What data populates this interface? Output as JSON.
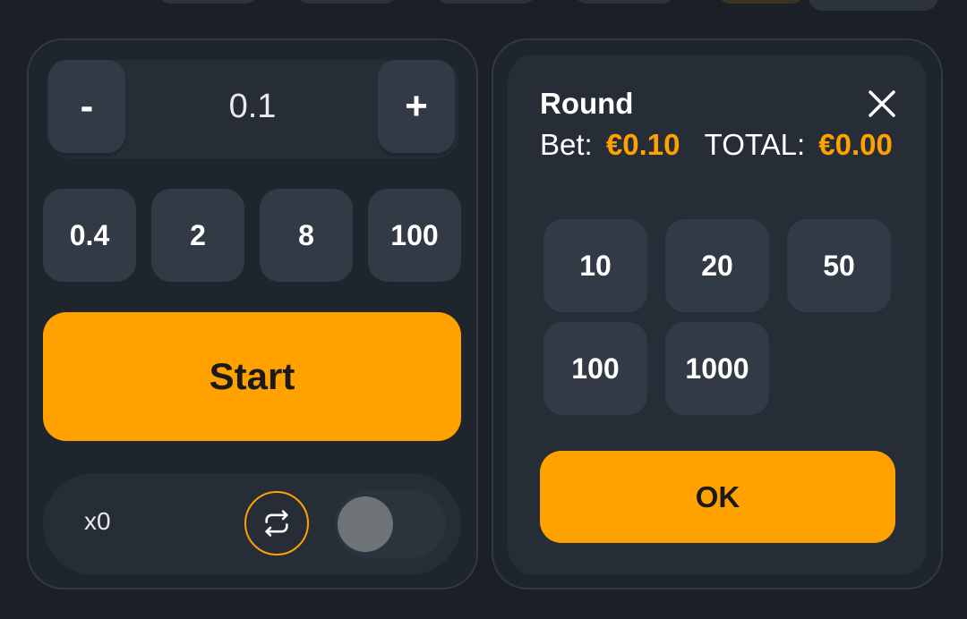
{
  "colors": {
    "accent": "#ffa200",
    "bg": "#1b2027",
    "panel": "#262d36",
    "button": "#323a45"
  },
  "bet_panel": {
    "amount": "0.1",
    "decrement_label": "-",
    "increment_label": "+",
    "presets": [
      "0.4",
      "2",
      "8",
      "100"
    ],
    "start_label": "Start",
    "autoplay": {
      "multiplier": "x0",
      "icon": "repeat-icon",
      "toggle_on": false
    }
  },
  "round_panel": {
    "title": "Round",
    "bet_label": "Bet:",
    "bet_value": "€0.10",
    "total_label": "TOTAL:",
    "total_value": "€0.00",
    "rounds": [
      "10",
      "20",
      "50",
      "100",
      "1000"
    ],
    "ok_label": "OK"
  }
}
